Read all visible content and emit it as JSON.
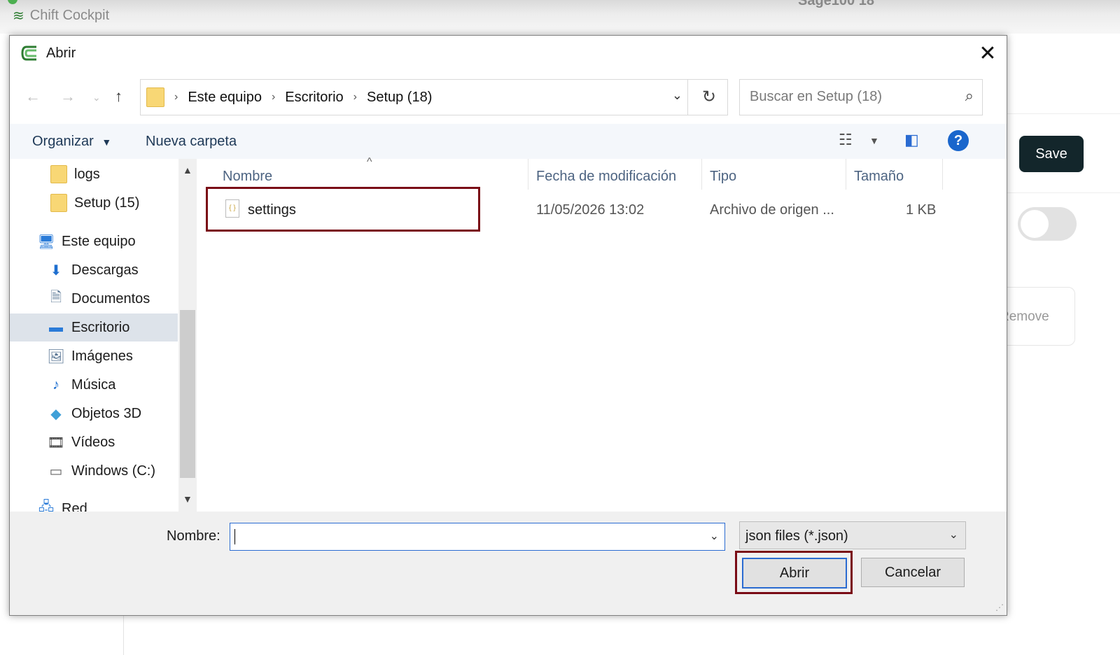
{
  "background": {
    "app_title": "Chift Cockpit",
    "right_title": "Sage100 18",
    "save_label": "Save",
    "remove_label": "Remove"
  },
  "dialog": {
    "title": "Abrir",
    "address": {
      "crumbs": [
        "Este equipo",
        "Escritorio",
        "Setup (18)"
      ]
    },
    "search_placeholder": "Buscar en Setup (18)",
    "toolbar": {
      "organize_label": "Organizar",
      "new_folder_label": "Nueva carpeta"
    },
    "sidebar": {
      "items": [
        {
          "label": "logs",
          "icon": "folder-icon"
        },
        {
          "label": "Setup (15)",
          "icon": "folder-icon"
        },
        {
          "label": "Este equipo",
          "icon": "computer-icon"
        },
        {
          "label": "Descargas",
          "icon": "download-icon"
        },
        {
          "label": "Documentos",
          "icon": "document-icon"
        },
        {
          "label": "Escritorio",
          "icon": "desktop-icon",
          "selected": true
        },
        {
          "label": "Imágenes",
          "icon": "image-icon"
        },
        {
          "label": "Música",
          "icon": "music-icon"
        },
        {
          "label": "Objetos 3D",
          "icon": "cube-icon"
        },
        {
          "label": "Vídeos",
          "icon": "video-icon"
        },
        {
          "label": "Windows (C:)",
          "icon": "drive-icon"
        },
        {
          "label": "Red",
          "icon": "network-icon"
        }
      ]
    },
    "columns": [
      "Nombre",
      "Fecha de modificación",
      "Tipo",
      "Tamaño"
    ],
    "files": [
      {
        "name": "settings",
        "modified": "11/05/2026 13:02",
        "type": "Archivo de origen ...",
        "size": "1 KB"
      }
    ],
    "filename_label": "Nombre:",
    "filename_value": "",
    "filter_value": "json files (*.json)",
    "open_label": "Abrir",
    "cancel_label": "Cancelar"
  },
  "colors": {
    "highlight": "#7a0c16",
    "accent": "#2a6bd1",
    "save_button": "#13262b"
  }
}
